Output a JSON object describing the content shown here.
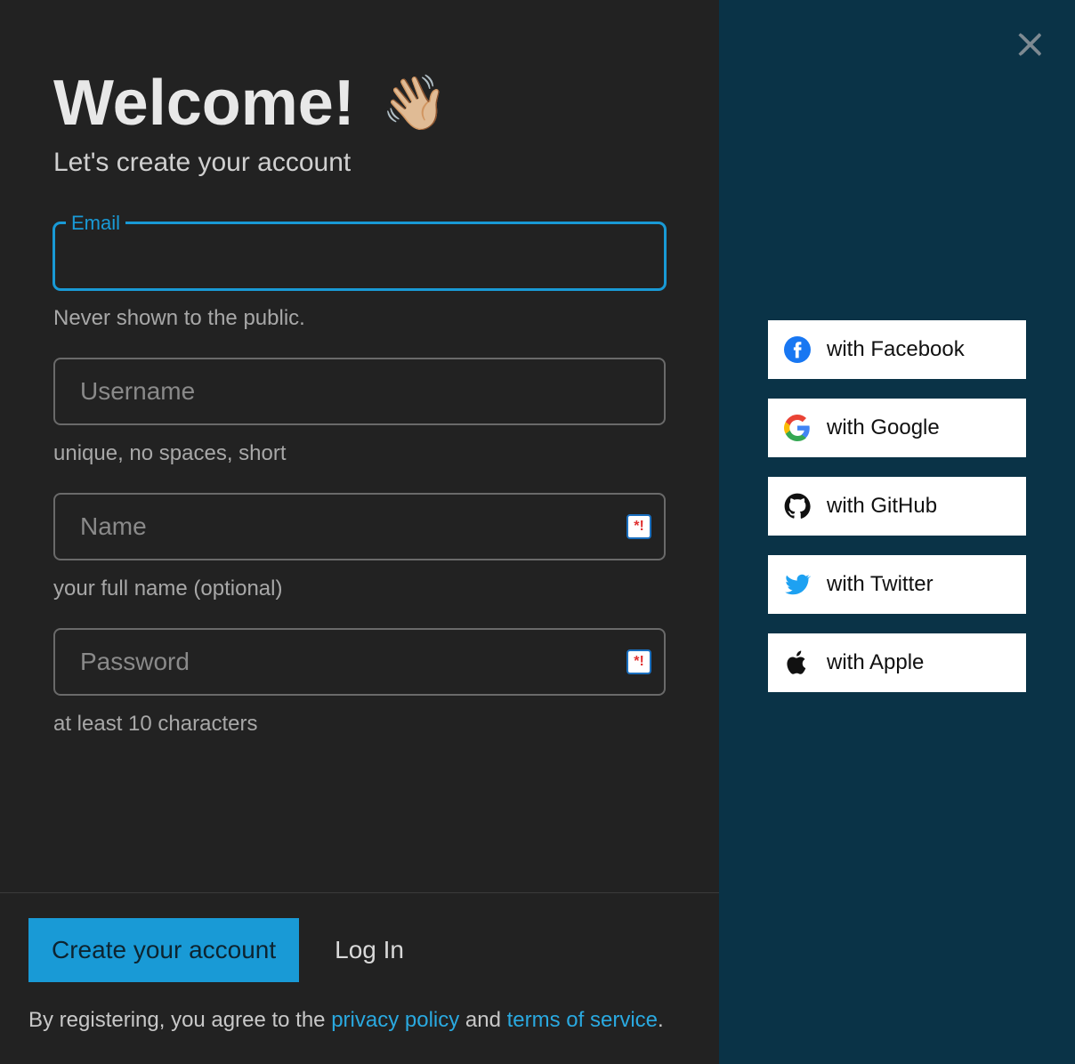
{
  "header": {
    "title": "Welcome!",
    "wave_emoji": "👋🏼",
    "subtitle": "Let's create your account"
  },
  "form": {
    "email": {
      "label": "Email",
      "value": "",
      "hint": "Never shown to the public."
    },
    "username": {
      "placeholder": "Username",
      "value": "",
      "hint": "unique, no spaces, short"
    },
    "name": {
      "placeholder": "Name",
      "value": "",
      "hint": "your full name (optional)"
    },
    "password": {
      "placeholder": "Password",
      "value": "",
      "hint": "at least 10 characters"
    }
  },
  "actions": {
    "create_label": "Create your account",
    "login_label": "Log In"
  },
  "legal": {
    "prefix": "By registering, you agree to the ",
    "privacy": "privacy policy",
    "middle": " and ",
    "terms": "terms of service",
    "suffix": "."
  },
  "social": {
    "facebook": "with Facebook",
    "google": "with Google",
    "github": "with GitHub",
    "twitter": "with Twitter",
    "apple": "with Apple"
  }
}
